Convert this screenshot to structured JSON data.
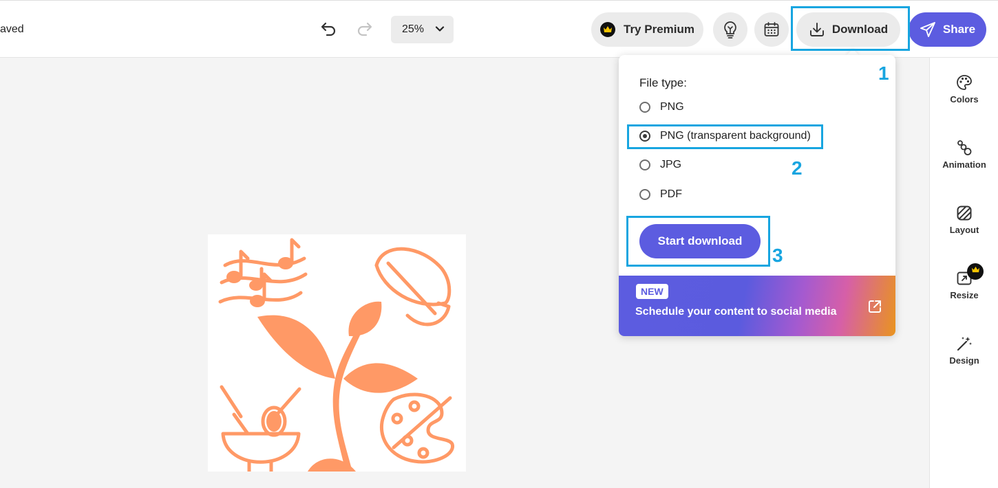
{
  "header": {
    "save_status": "aved",
    "zoom_value": "25%",
    "try_premium_label": "Try Premium",
    "download_label": "Download",
    "share_label": "Share"
  },
  "download_panel": {
    "file_type_label": "File type:",
    "options": [
      {
        "label": "PNG",
        "selected": false
      },
      {
        "label": "PNG (transparent background)",
        "selected": true
      },
      {
        "label": "JPG",
        "selected": false
      },
      {
        "label": "PDF",
        "selected": false
      }
    ],
    "start_button_label": "Start download",
    "promo": {
      "badge": "NEW",
      "text": "Schedule your content to social media"
    }
  },
  "sidebar": {
    "items": [
      {
        "label": "Colors",
        "icon": "palette-icon"
      },
      {
        "label": "Animation",
        "icon": "animation-icon"
      },
      {
        "label": "Layout",
        "icon": "layout-icon"
      },
      {
        "label": "Resize",
        "icon": "resize-icon",
        "premium": true
      },
      {
        "label": "Design",
        "icon": "magic-wand-icon"
      }
    ]
  },
  "annotations": [
    "1",
    "2",
    "3"
  ],
  "colors": {
    "accent": "#5c5ce0",
    "highlight": "#17a5e0",
    "artwork": "#ff9966"
  }
}
